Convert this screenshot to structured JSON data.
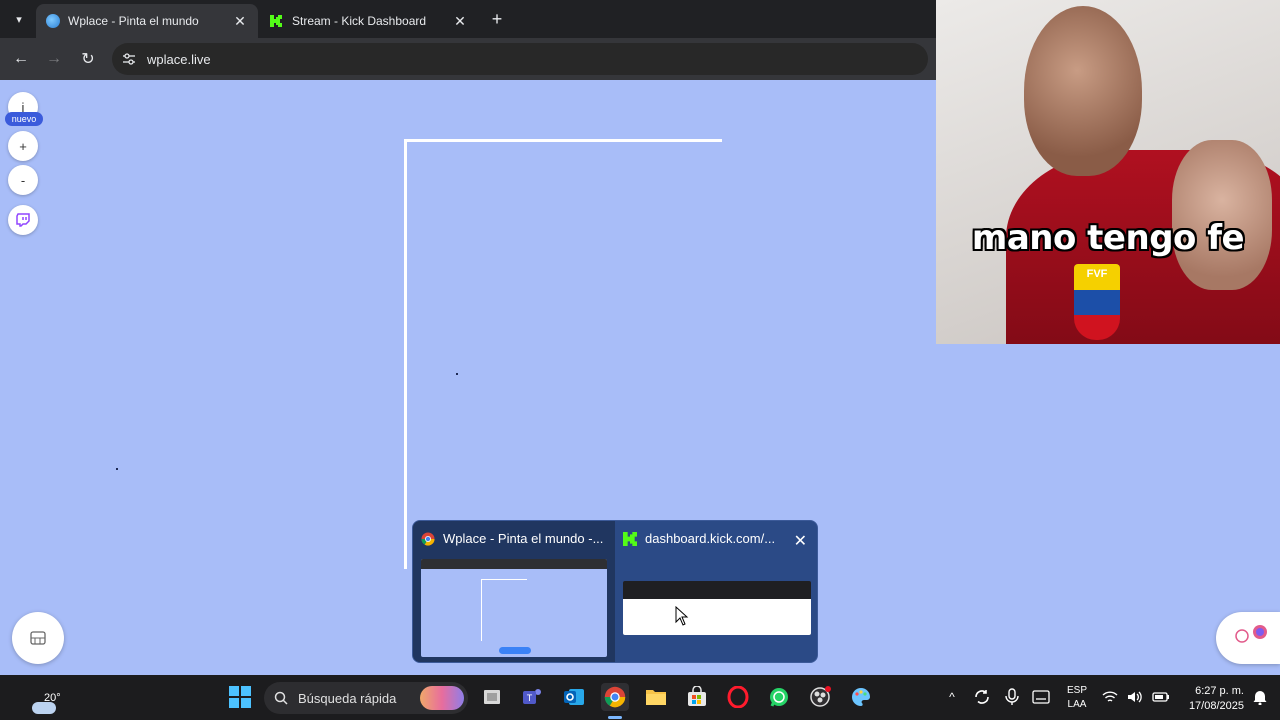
{
  "browser": {
    "tabs": [
      {
        "title": "Wplace - Pinta el mundo",
        "active": true
      },
      {
        "title": "Stream - Kick Dashboard",
        "active": false
      }
    ],
    "url": "wplace.live"
  },
  "wplace": {
    "info_label": "i",
    "new_badge": "nuevo",
    "zoom_in": "+",
    "zoom_out": "-"
  },
  "webcam": {
    "caption": "mano tengo fe",
    "badge_text": "FVF"
  },
  "taskbar_preview": {
    "windows": [
      {
        "title": "Wplace - Pinta el mundo -..."
      },
      {
        "title": "dashboard.kick.com/..."
      }
    ]
  },
  "taskbar": {
    "temperature": "20°",
    "search_placeholder": "Búsqueda rápida",
    "lang_line1": "ESP",
    "lang_line2": "LAA",
    "time": "6:27 p. m.",
    "date": "17/08/2025"
  },
  "colors": {
    "canvas_bg": "#a8bdf8",
    "kick_green": "#53fc18",
    "accent_blue": "#3b5bdb"
  }
}
